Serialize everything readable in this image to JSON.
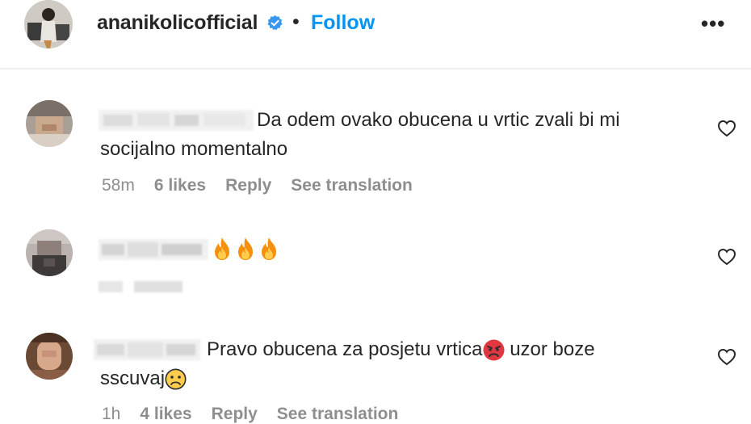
{
  "header": {
    "username": "ananikolicofficial",
    "separator": "•",
    "follow_label": "Follow",
    "more_label": "•••"
  },
  "comments": [
    {
      "text_line1": "Da odem ovako obucena u vrtic zvali bi mi",
      "text_line2": "socijalno momentalno",
      "time": "58m",
      "likes": "6 likes",
      "reply": "Reply",
      "see_translation": "See translation"
    },
    {
      "emoji": [
        "fire",
        "fire",
        "fire"
      ]
    },
    {
      "text_line1_a": "Pravo obucena za posjetu vrtica",
      "text_line1_b": "uzor boze",
      "text_line2": "sscuvaj",
      "time": "1h",
      "likes": "4 likes",
      "reply": "Reply",
      "see_translation": "See translation"
    }
  ],
  "colors": {
    "accent": "#0095f6",
    "text": "#262626",
    "muted": "#8e8e8e"
  }
}
